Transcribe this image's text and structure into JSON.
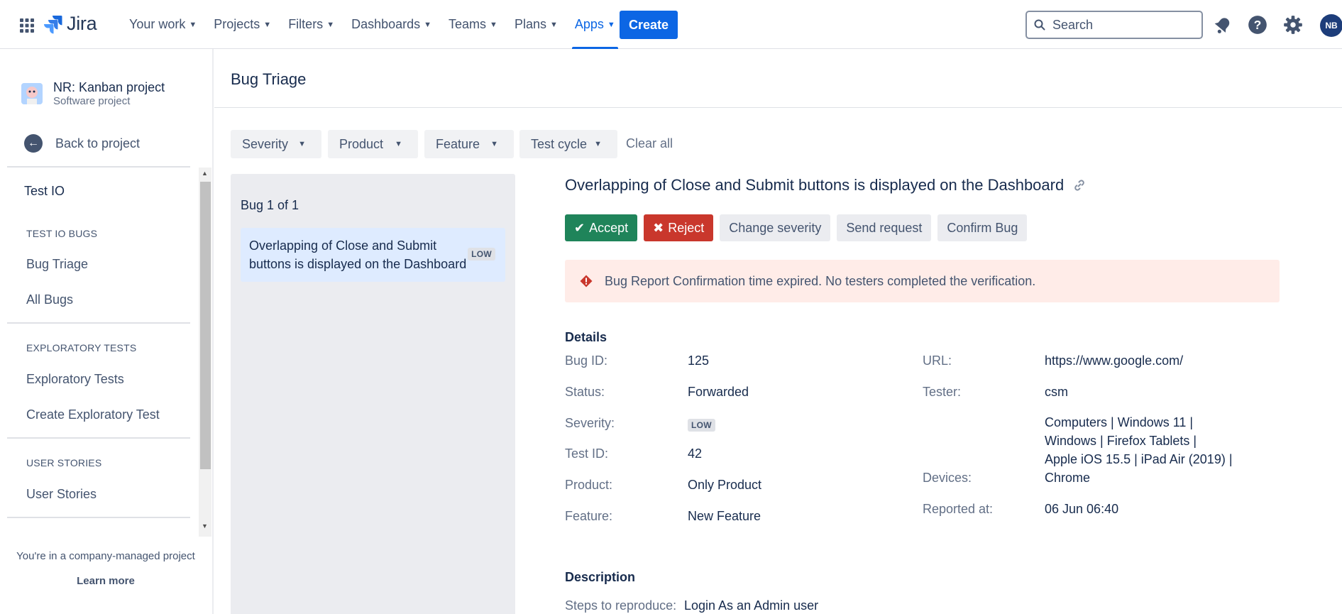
{
  "nav": {
    "logo": "Jira",
    "items": [
      {
        "label": "Your work"
      },
      {
        "label": "Projects"
      },
      {
        "label": "Filters"
      },
      {
        "label": "Dashboards"
      },
      {
        "label": "Teams"
      },
      {
        "label": "Plans"
      },
      {
        "label": "Apps"
      }
    ],
    "active_item": "Apps",
    "create_label": "Create",
    "search_placeholder": "Search",
    "avatar_initials": "NB",
    "accent_color": "#0c66e4"
  },
  "sidebar": {
    "project_name": "NR: Kanban project",
    "project_type": "Software project",
    "back_label": "Back to project",
    "app_title": "Test IO",
    "sections": [
      {
        "heading": "TEST IO BUGS",
        "items": [
          "Bug Triage",
          "All Bugs"
        ]
      },
      {
        "heading": "EXPLORATORY TESTS",
        "items": [
          "Exploratory Tests",
          "Create Exploratory Test"
        ]
      },
      {
        "heading": "USER STORIES",
        "items": [
          "User Stories"
        ]
      }
    ],
    "footer_text": "You're in a company-managed project",
    "learn_more": "Learn more"
  },
  "main": {
    "page_title": "Bug Triage",
    "filters": [
      "Severity",
      "Product",
      "Feature",
      "Test cycle"
    ],
    "clear_all": "Clear all",
    "bug_count": "Bug 1 of 1",
    "bug_card": {
      "title": "Overlapping of Close and Submit buttons is displayed on the Dashboard",
      "severity": "LOW"
    }
  },
  "detail": {
    "title": "Overlapping of Close and Submit buttons is displayed on the Dashboard",
    "actions": {
      "accept": "Accept",
      "reject": "Reject",
      "change_severity": "Change severity",
      "send_request": "Send request",
      "confirm_bug": "Confirm Bug"
    },
    "alert": "Bug Report Confirmation time expired. No testers completed the verification.",
    "details_heading": "Details",
    "left": [
      {
        "label": "Bug ID:",
        "value": "125"
      },
      {
        "label": "Status:",
        "value": "Forwarded"
      },
      {
        "label": "Severity:",
        "value": "LOW"
      },
      {
        "label": "Test ID:",
        "value": "42"
      },
      {
        "label": "Product:",
        "value": "Only Product"
      },
      {
        "label": "Feature:",
        "value": "New Feature"
      }
    ],
    "right": [
      {
        "label": "URL:",
        "value": "https://www.google.com/"
      },
      {
        "label": "Tester:",
        "value": "csm"
      },
      {
        "label": "Devices:",
        "value_lines": [
          "Computers | Windows 11 |",
          "Windows | Firefox Tablets |",
          "Apple iOS 15.5 | iPad Air (2019) |",
          "Chrome"
        ]
      },
      {
        "label": "Reported at:",
        "value": "06 Jun 06:40"
      }
    ],
    "description_heading": "Description",
    "steps_label": "Steps to reproduce:",
    "steps_value": "Login As an Admin user"
  }
}
